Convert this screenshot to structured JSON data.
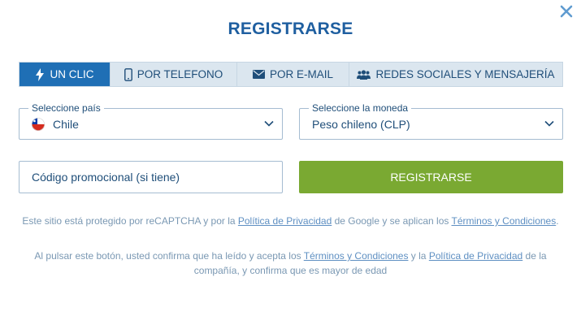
{
  "title": "REGISTRARSE",
  "close_icon": "close-icon",
  "tabs": [
    {
      "label": "UN CLIC",
      "icon": "lightning-icon",
      "active": true
    },
    {
      "label": "POR TELEFONO",
      "icon": "phone-icon",
      "active": false
    },
    {
      "label": "POR E-MAIL",
      "icon": "envelope-icon",
      "active": false
    },
    {
      "label": "REDES SOCIALES Y MENSAJERÍA",
      "icon": "users-icon",
      "active": false
    }
  ],
  "country": {
    "label": "Seleccione país",
    "value": "Chile",
    "flag": "chile-flag-icon"
  },
  "currency": {
    "label": "Seleccione la moneda",
    "value": "Peso chileno (CLP)"
  },
  "promo": {
    "placeholder": "Código promocional (si tiene)"
  },
  "register_button": "REGISTRARSE",
  "recaptcha_note": {
    "text1": "Este sitio está protegido por reCAPTCHA y por la ",
    "link1": "Política de Privacidad",
    "text2": " de Google y se aplican los ",
    "link2": "Términos y Condiciones",
    "text3": "."
  },
  "terms_note": {
    "text1": "Al pulsar este botón, usted confirma que ha leído y acepta los ",
    "link1": "Términos y Condiciones",
    "text2": " y la ",
    "link2": "Política de Privacidad",
    "text3": " de la compañía, y confirma que es mayor de edad"
  },
  "colors": {
    "primary": "#1f6fb5",
    "title": "#1f5fa0",
    "register": "#7aa932",
    "tabs_bg": "#dbe6ef",
    "note": "#7a98b3"
  }
}
